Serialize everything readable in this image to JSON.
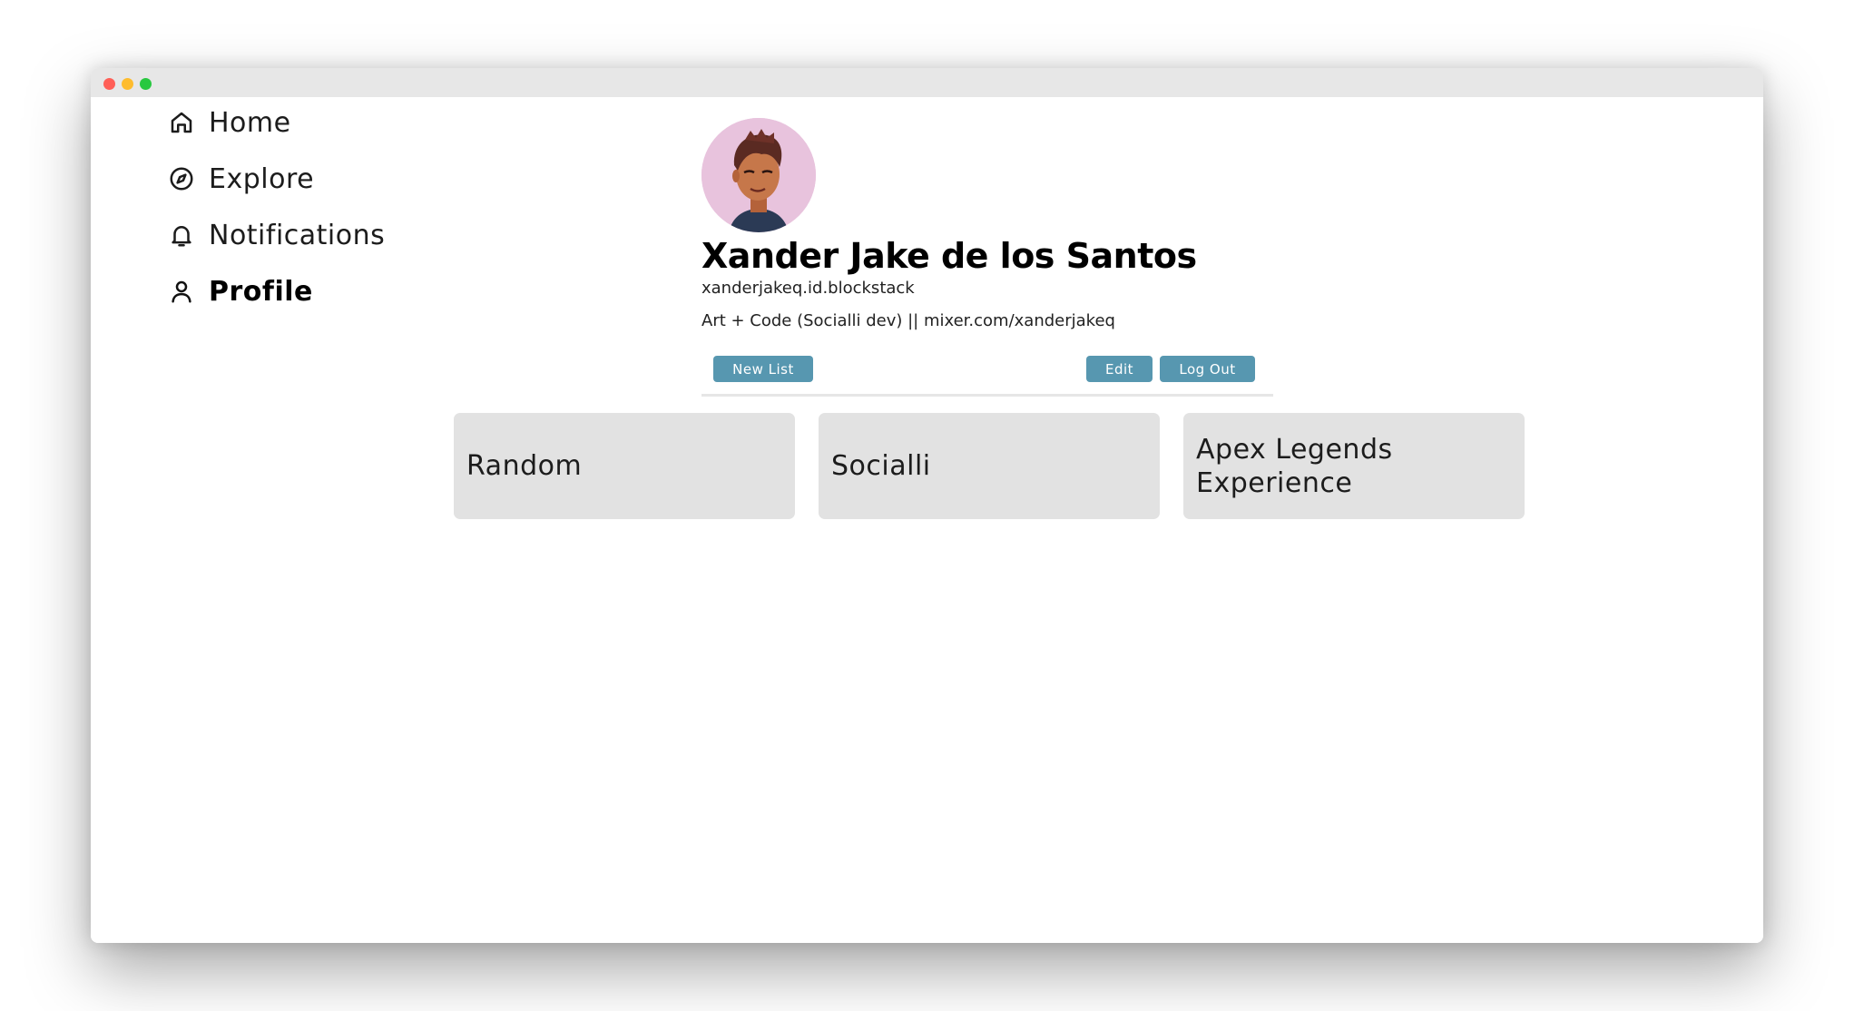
{
  "nav": {
    "items": [
      {
        "label": "Home",
        "icon": "home-icon"
      },
      {
        "label": "Explore",
        "icon": "compass-icon"
      },
      {
        "label": "Notifications",
        "icon": "bell-icon"
      },
      {
        "label": "Profile",
        "icon": "user-icon",
        "active": true
      }
    ]
  },
  "profile": {
    "name": "Xander Jake de los Santos",
    "handle": "xanderjakeq.id.blockstack",
    "bio": "Art + Code (Socialli dev) || mixer.com/xanderjakeq",
    "avatar_bg": "#e8c3dd"
  },
  "actions": {
    "new_list": "New List",
    "edit": "Edit",
    "log_out": "Log Out",
    "button_color": "#5797b0"
  },
  "lists": [
    {
      "name": "Random"
    },
    {
      "name": "Socialli"
    },
    {
      "name": "Apex Legends Experience"
    }
  ]
}
